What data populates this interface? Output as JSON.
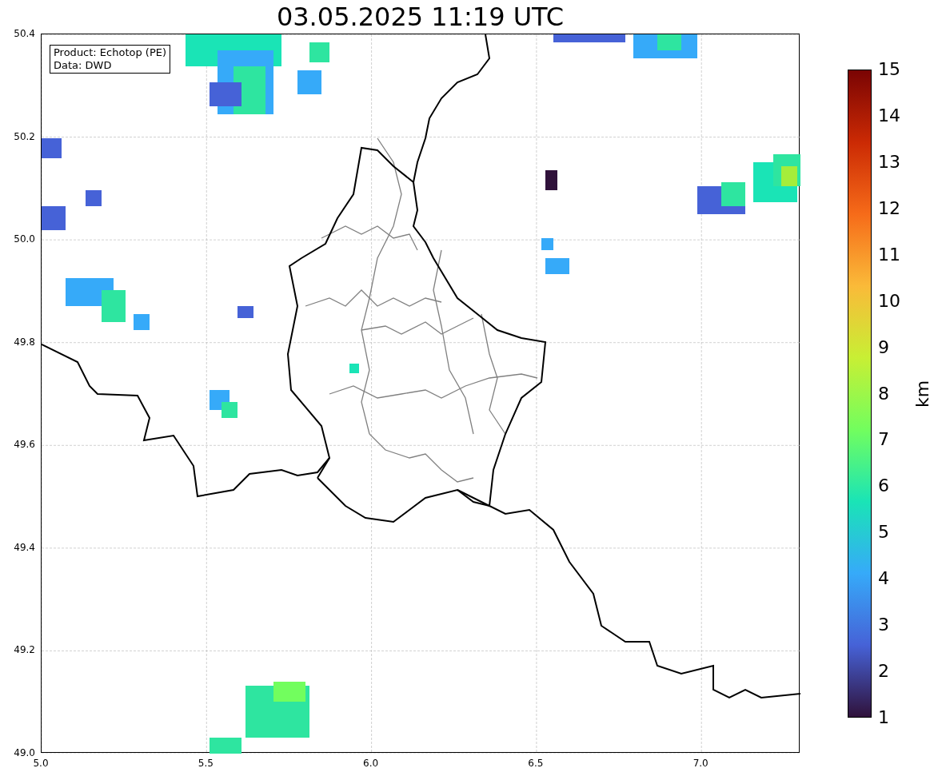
{
  "title": "03.05.2025 11:19 UTC",
  "annotation": [
    "Product: Echotop (PE)",
    "Data: DWD"
  ],
  "x_axis": {
    "ticks": [
      "5.0",
      "5.5",
      "6.0",
      "6.5",
      "7.0"
    ]
  },
  "y_axis": {
    "ticks": [
      "50.4",
      "50.2",
      "50.0",
      "49.8",
      "49.6",
      "49.4",
      "49.2",
      "49.0"
    ]
  },
  "colorbar": {
    "label": "km",
    "ticks": [
      "15",
      "14",
      "13",
      "12",
      "11",
      "10",
      "9",
      "8",
      "7",
      "6",
      "5",
      "4",
      "3",
      "2",
      "1"
    ]
  }
}
